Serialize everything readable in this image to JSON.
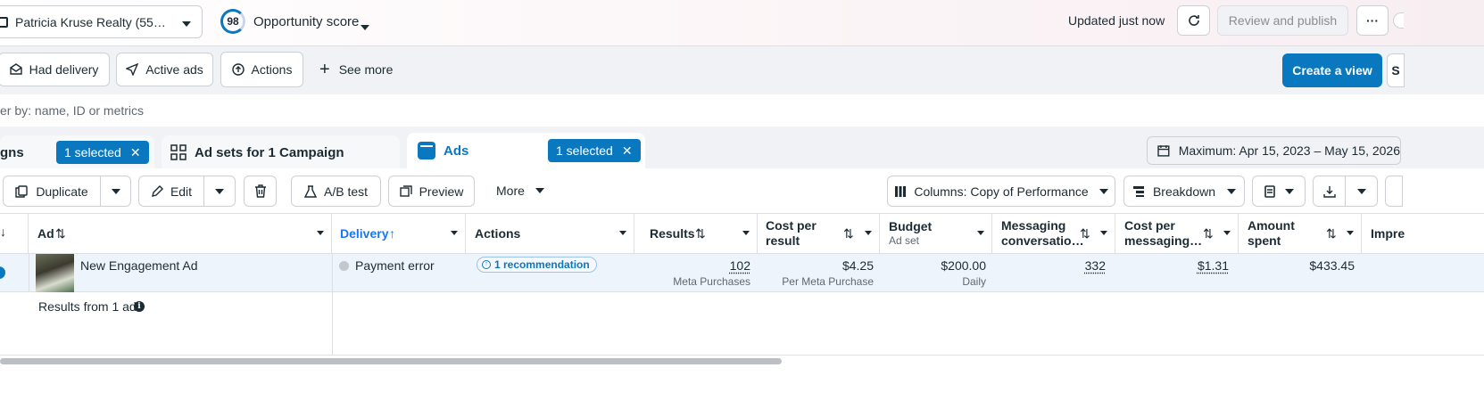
{
  "topbar": {
    "account_name": "Patricia Kruse Realty (55…",
    "opportunity_score": "98",
    "opportunity_label": "Opportunity score",
    "updated_text": "Updated just now",
    "review_publish_label": "Review and publish",
    "more_label": "···"
  },
  "filters": {
    "items": [
      {
        "label": "Had delivery"
      },
      {
        "label": "Active ads"
      },
      {
        "label": "Actions"
      }
    ],
    "see_more_label": "See more",
    "create_view_label": "Create a view"
  },
  "search": {
    "placeholder": "er by: name, ID or metrics"
  },
  "tabs": {
    "campaigns_label": "gns",
    "campaigns_selected": "1 selected",
    "adsets_label": "Ad sets for 1 Campaign",
    "ads_label": "Ads",
    "ads_selected": "1 selected",
    "date_range": "Maximum: Apr 15, 2023 – May 15, 2026"
  },
  "toolbar": {
    "duplicate_label": "Duplicate",
    "edit_label": "Edit",
    "ab_test_label": "A/B test",
    "preview_label": "Preview",
    "more_label": "More",
    "columns_label": "Columns: Copy of Performance",
    "breakdown_label": "Breakdown"
  },
  "table": {
    "headers": {
      "ad": "Ad",
      "delivery": "Delivery",
      "actions": "Actions",
      "results": "Results",
      "cost_per_result_1": "Cost per",
      "cost_per_result_2": "result",
      "budget": "Budget",
      "budget_sub": "Ad set",
      "messaging_1": "Messaging",
      "messaging_2": "conversatio…",
      "cost_messaging_1": "Cost per",
      "cost_messaging_2": "messaging…",
      "amount_1": "Amount",
      "amount_2": "spent",
      "impressions": "Impre"
    },
    "row": {
      "ad_name": "New Engagement Ad",
      "delivery_status": "Payment error",
      "recommendation": "1 recommendation",
      "results_value": "102",
      "results_sub": "Meta Purchases",
      "cost_per_result": "$4.25",
      "cost_per_result_sub": "Per Meta Purchase",
      "budget": "$200.00",
      "budget_sub": "Daily",
      "messaging": "332",
      "cost_messaging": "$1.31",
      "amount_spent": "$433.45"
    },
    "summary": "Results from 1 ad"
  },
  "colors": {
    "accent": "#0a78be",
    "delivery_header": "#1877f2",
    "status_dot": "#c4c8cc"
  }
}
